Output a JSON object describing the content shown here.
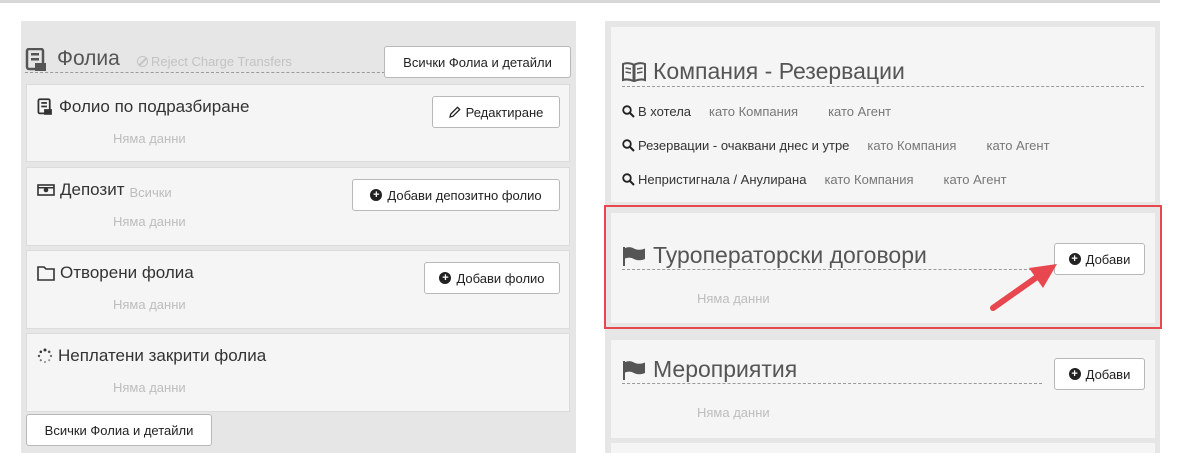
{
  "folio": {
    "title": "Фолиа",
    "subtitle": "Reject Charge Transfers",
    "all_button": "Всички Фолиа и детайли",
    "bottom_all_button": "Всички Фолиа и детайли",
    "cards": [
      {
        "title": "Фолио по подразбиране",
        "subtitle": "",
        "button": "Редактиране",
        "empty": "Няма данни"
      },
      {
        "title": "Депозит",
        "subtitle": "Всички",
        "button": "Добави депозитно фолио",
        "empty": "Няма данни"
      },
      {
        "title": "Отворени фолиа",
        "subtitle": "",
        "button": "Добави фолио",
        "empty": "Няма данни"
      },
      {
        "title": "Неплатени закрити фолиа",
        "subtitle": "",
        "button": "",
        "empty": "Няма данни"
      }
    ]
  },
  "company": {
    "title": "Компания - Резервации",
    "rows": [
      {
        "label": "В хотела",
        "as_company": "като Компания",
        "as_agent": "като Агент"
      },
      {
        "label": "Резервации - очаквани днес и утре",
        "as_company": "като Компания",
        "as_agent": "като Агент"
      },
      {
        "label": "Непристигнала / Анулирана",
        "as_company": "като Компания",
        "as_agent": "като Агент"
      }
    ]
  },
  "tour_operators": {
    "title": "Туроператорски договори",
    "button": "Добави",
    "empty": "Няма данни"
  },
  "events": {
    "title": "Мероприятия",
    "button": "Добави",
    "empty": "Няма данни"
  },
  "colors": {
    "highlight": "#e8474f",
    "panel_bg": "#e6e6e6",
    "card_bg": "#f5f5f5"
  }
}
